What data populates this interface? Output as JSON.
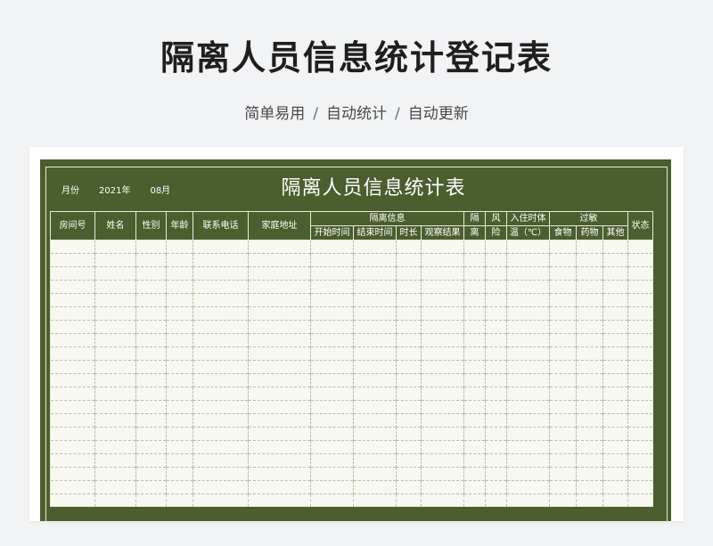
{
  "header": {
    "title": "隔离人员信息统计登记表",
    "features": [
      "简单易用",
      "自动统计",
      "自动更新"
    ],
    "separator": "/"
  },
  "sheet": {
    "month_label": "月份",
    "year": "2021年",
    "month": "08月",
    "title": "隔离人员信息统计表",
    "columns": {
      "room_no": "房间号",
      "name": "姓名",
      "gender": "性别",
      "age": "年龄",
      "phone": "联系电话",
      "address": "家庭地址",
      "isolation_group": "隔离信息",
      "iso_start": "开始时间",
      "iso_end": "结束时间",
      "iso_duration": "时长",
      "iso_result": "观察结果",
      "isolation_a": "隔",
      "isolation_b": "离",
      "risk_a": "风",
      "risk_b": "险",
      "temp_a": "入住时体",
      "temp_b": "温（℃）",
      "allergy_group": "过敏",
      "allergy_food": "食物",
      "allergy_drug": "药物",
      "allergy_other": "其他",
      "status": "状态"
    },
    "empty_rows": 20
  }
}
